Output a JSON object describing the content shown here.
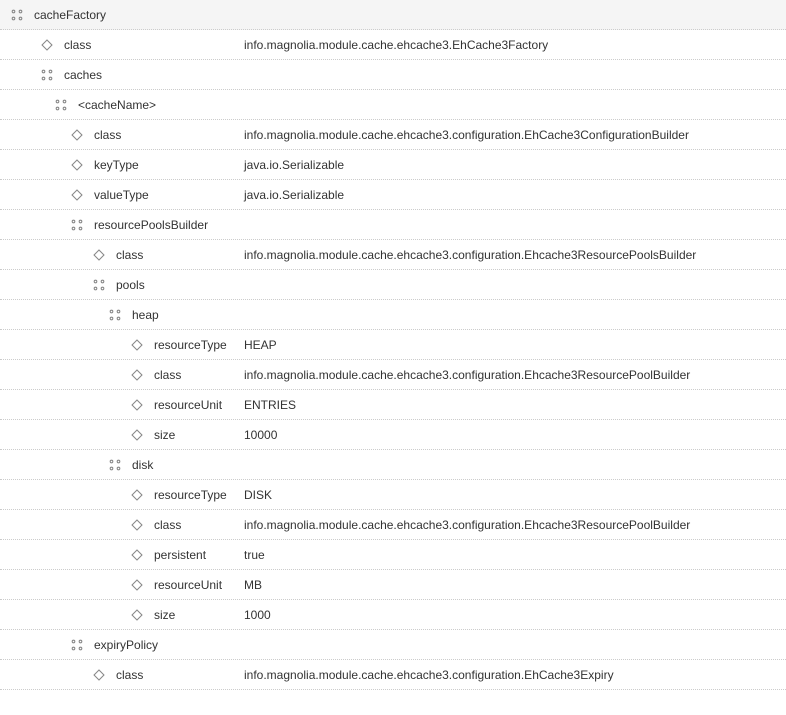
{
  "tree": {
    "root": {
      "label": "cacheFactory",
      "children": {
        "class": {
          "label": "class",
          "value": "info.magnolia.module.cache.ehcache3.EhCache3Factory"
        },
        "caches": {
          "label": "caches",
          "children": {
            "cacheName": {
              "label": "<cacheName>",
              "children": {
                "class": {
                  "label": "class",
                  "value": "info.magnolia.module.cache.ehcache3.configuration.EhCache3ConfigurationBuilder"
                },
                "keyType": {
                  "label": "keyType",
                  "value": "java.io.Serializable"
                },
                "valueType": {
                  "label": "valueType",
                  "value": "java.io.Serializable"
                },
                "resourcePoolsBuilder": {
                  "label": "resourcePoolsBuilder",
                  "children": {
                    "class": {
                      "label": "class",
                      "value": "info.magnolia.module.cache.ehcache3.configuration.Ehcache3ResourcePoolsBuilder"
                    },
                    "pools": {
                      "label": "pools",
                      "children": {
                        "heap": {
                          "label": "heap",
                          "children": {
                            "resourceType": {
                              "label": "resourceType",
                              "value": "HEAP"
                            },
                            "class": {
                              "label": "class",
                              "value": "info.magnolia.module.cache.ehcache3.configuration.Ehcache3ResourcePoolBuilder"
                            },
                            "resourceUnit": {
                              "label": "resourceUnit",
                              "value": "ENTRIES"
                            },
                            "size": {
                              "label": "size",
                              "value": "10000"
                            }
                          }
                        },
                        "disk": {
                          "label": "disk",
                          "children": {
                            "resourceType": {
                              "label": "resourceType",
                              "value": "DISK"
                            },
                            "class": {
                              "label": "class",
                              "value": "info.magnolia.module.cache.ehcache3.configuration.Ehcache3ResourcePoolBuilder"
                            },
                            "persistent": {
                              "label": "persistent",
                              "value": "true"
                            },
                            "resourceUnit": {
                              "label": "resourceUnit",
                              "value": "MB"
                            },
                            "size": {
                              "label": "size",
                              "value": "1000"
                            }
                          }
                        }
                      }
                    }
                  }
                },
                "expiryPolicy": {
                  "label": "expiryPolicy",
                  "children": {
                    "class": {
                      "label": "class",
                      "value": "info.magnolia.module.cache.ehcache3.configuration.EhCache3Expiry"
                    }
                  }
                }
              }
            }
          }
        }
      }
    }
  }
}
